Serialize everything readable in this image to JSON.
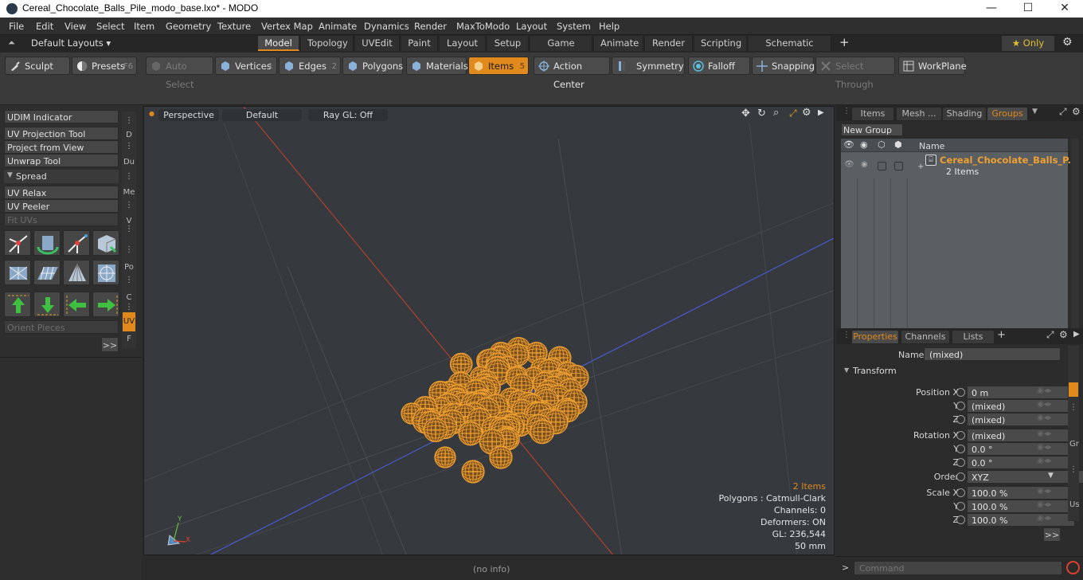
{
  "window": {
    "title": "Cereal_Chocolate_Balls_Pile_modo_base.lxo* - MODO",
    "controls": [
      "—",
      "☐",
      "✕"
    ]
  },
  "menu": [
    "File",
    "Edit",
    "View",
    "Select",
    "Item",
    "Geometry",
    "Texture",
    "Vertex Map",
    "Animate",
    "Dynamics",
    "Render",
    "MaxToModo",
    "Layout",
    "System",
    "Help"
  ],
  "layouts": {
    "default_label": "Default Layouts ▾",
    "tabs": [
      "Model",
      "Topology",
      "UVEdit",
      "Paint",
      "Layout",
      "Setup",
      "Game Tools",
      "Animate",
      "Render",
      "Scripting",
      "Schematic Fusion"
    ],
    "active": "Model",
    "add": "+",
    "only": "★  Only"
  },
  "toolbar": {
    "sculpt": "Sculpt",
    "presets": "Presets",
    "presets_key": "F6",
    "auto_select": "Auto Select",
    "vertices": "Vertices",
    "vertices_num": "1",
    "edges": "Edges",
    "edges_num": "2",
    "polygons": "Polygons",
    "materials": "Materials",
    "items": "Items",
    "items_num": "5",
    "action_center": "Action Center",
    "symmetry": "Symmetry",
    "falloff": "Falloff",
    "snapping": "Snapping",
    "select_through": "Select Through",
    "workplane": "WorkPlane"
  },
  "leftpanel": {
    "udim": "UDIM Indicator",
    "uv_projection": "UV Projection Tool",
    "project_view": "Project from View",
    "unwrap": "Unwrap Tool",
    "spread": "Spread",
    "uv_relax": "UV Relax",
    "uv_peeler": "UV Peeler",
    "fit_uvs": "Fit UVs",
    "orient": "Orient Pieces",
    "more": ">>",
    "vtabs": [
      "D",
      "Du",
      "Me",
      "V",
      "Po",
      "C",
      "UV",
      "F"
    ]
  },
  "viewport": {
    "perspective": "Perspective",
    "default": "Default",
    "raygl": "Ray GL: Off",
    "info": {
      "items": "2 Items",
      "polygons": "Polygons : Catmull-Clark",
      "channels": "Channels: 0",
      "deformers": "Deformers: ON",
      "gl": "GL: 236,544",
      "mm": "50 mm"
    },
    "axis_y": "Y",
    "axis_x": "X"
  },
  "status": {
    "noinfo": "(no info)",
    "command_placeholder": "Command",
    "prompt": ">"
  },
  "groups": {
    "tabs": [
      "Items",
      "Mesh ...",
      "Shading",
      "Groups"
    ],
    "active": "Groups",
    "new_group": "New Group",
    "col_name": "Name",
    "item_name": "Cereal_Chocolate_Balls_P...",
    "item_sub": "2 Items"
  },
  "properties": {
    "tabs": [
      "Properties",
      "Channels",
      "Lists"
    ],
    "add": "+",
    "name_label": "Name",
    "name_value": "(mixed)",
    "transform": "Transform",
    "rows": [
      {
        "label": "Position X",
        "value": "0 m"
      },
      {
        "label": "Y",
        "value": "(mixed)"
      },
      {
        "label": "Z",
        "value": "(mixed)"
      },
      {
        "label": "Rotation X",
        "value": "(mixed)"
      },
      {
        "label": "Y",
        "value": "0.0 °"
      },
      {
        "label": "Z",
        "value": "0.0 °"
      },
      {
        "label": "Order",
        "value": "XYZ"
      },
      {
        "label": "Scale X",
        "value": "100.0 %"
      },
      {
        "label": "Y",
        "value": "100.0 %"
      },
      {
        "label": "Z",
        "value": "100.0 %"
      }
    ],
    "more": ">>",
    "side_tabs": [
      "Gr",
      "Us"
    ]
  },
  "colors": {
    "accent": "#e08a1e",
    "mesh": "#f0a030",
    "axis_red": "#b04030",
    "axis_blue": "#4a5ad0"
  }
}
